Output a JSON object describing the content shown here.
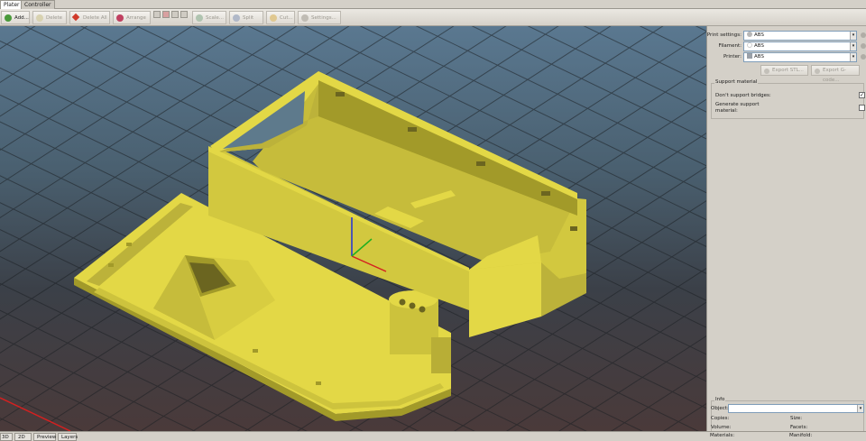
{
  "tabs": [
    {
      "label": "Plater",
      "active": true
    },
    {
      "label": "Controller",
      "active": false
    }
  ],
  "toolbar": {
    "add": "Add...",
    "delete": "Delete",
    "delete_all": "Delete All",
    "arrange": "Arrange",
    "scale": "Scale...",
    "split": "Split",
    "cut": "Cut...",
    "settings": "Settings..."
  },
  "panel": {
    "print_settings_label": "Print settings:",
    "print_settings_value": "ABS",
    "filament_label": "Filament:",
    "filament_value": "ABS",
    "printer_label": "Printer:",
    "printer_value": "ABS",
    "export_stl": "Export STL...",
    "export_gcode": "Export G-code...",
    "support_group": "Support material",
    "dont_support_bridges": "Don't support bridges:",
    "dont_support_bridges_checked": true,
    "generate_support_line1": "Generate support",
    "generate_support_line2": "material:",
    "generate_support_checked": false,
    "info_group": "Info",
    "object_label": "Object:",
    "object_value": "",
    "copies_label": "Copies:",
    "size_label": "Size:",
    "volume_label": "Volume:",
    "facets_label": "Facets:",
    "materials_label": "Materials:",
    "manifold_label": "Manifold:"
  },
  "view_tabs": [
    "3D",
    "2D",
    "Preview",
    "Layers"
  ],
  "colors": {
    "model": "#e3d846",
    "model_shadow": "#a29a29",
    "model_dark": "#bcb23a",
    "grid_line": "#1c2024",
    "axis_x": "#d42020",
    "axis_y": "#20b020",
    "axis_z": "#2030d8"
  }
}
